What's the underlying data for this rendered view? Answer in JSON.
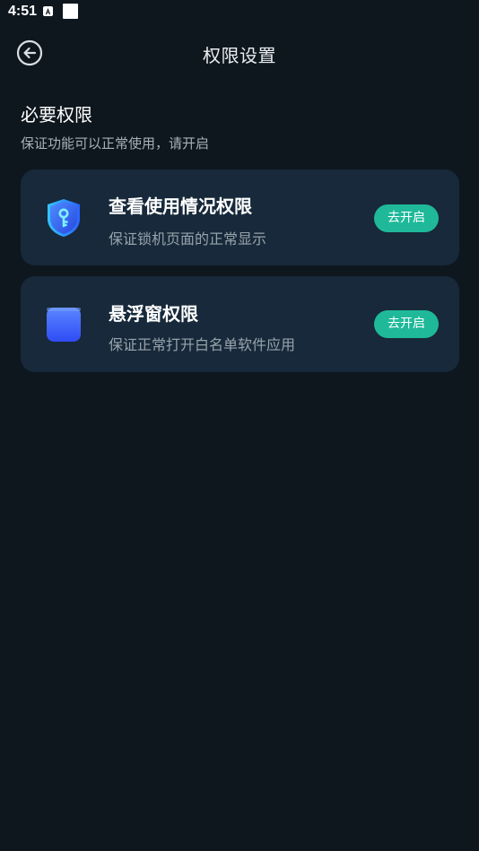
{
  "status_bar": {
    "time": "4:51"
  },
  "header": {
    "title": "权限设置",
    "back_icon": "back-arrow-circle-icon"
  },
  "section": {
    "title": "必要权限",
    "subtitle": "保证功能可以正常使用，请开启"
  },
  "permissions": [
    {
      "title": "查看使用情况权限",
      "description": "保证锁机页面的正常显示",
      "icon": "shield-key-icon",
      "button_label": "去开启"
    },
    {
      "title": "悬浮窗权限",
      "description": "保证正常打开白名单软件应用",
      "icon": "floating-window-icon",
      "button_label": "去开启"
    }
  ],
  "colors": {
    "background": "#0e171e",
    "card": "#17293a",
    "accent_button": "#1fb99a",
    "icon_blue": "#3a6bff"
  }
}
